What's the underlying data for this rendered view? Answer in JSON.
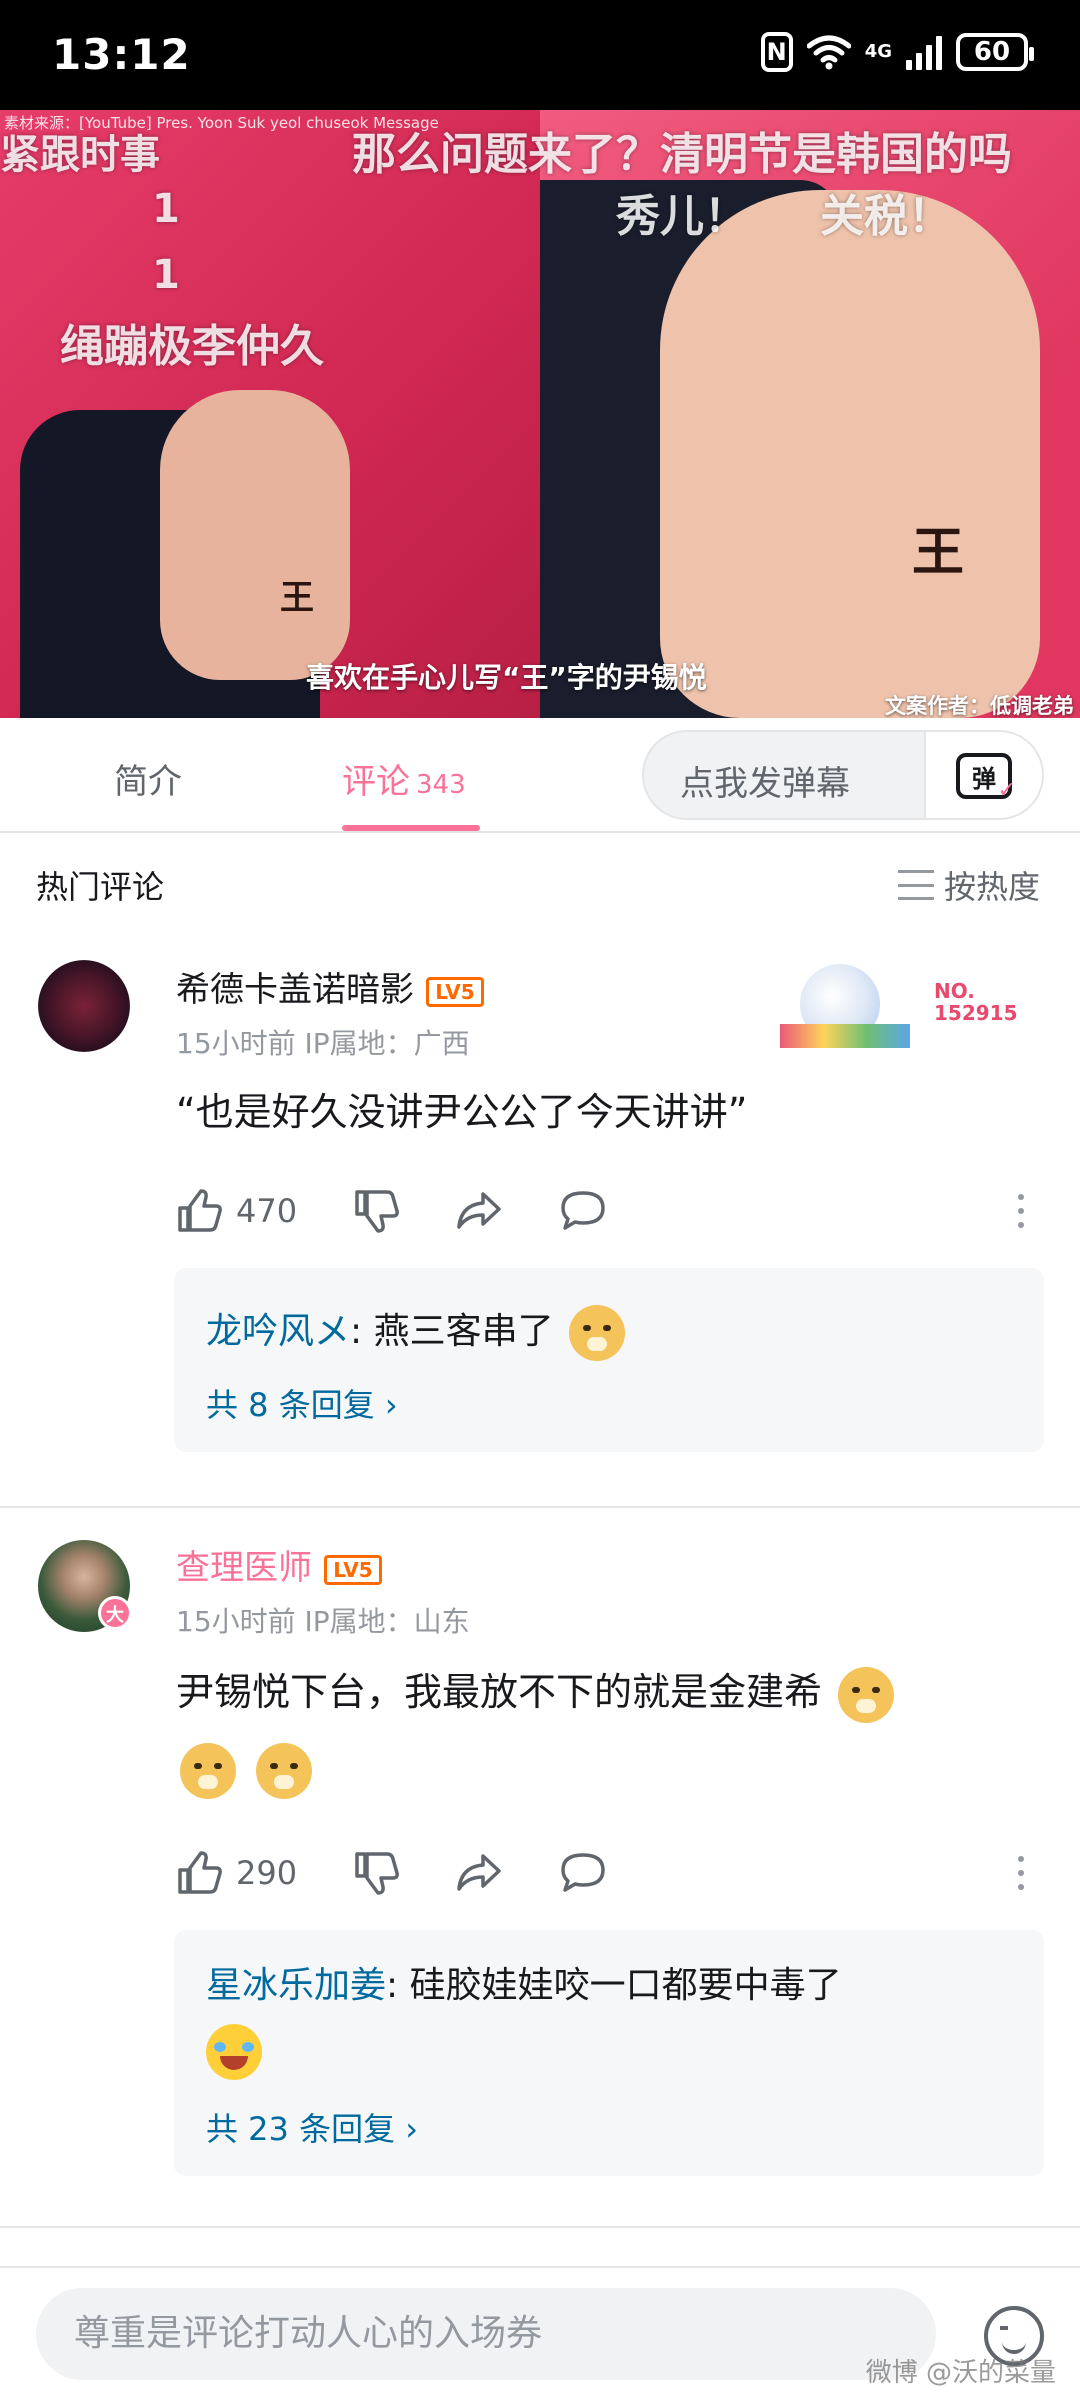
{
  "status_bar": {
    "time": "13:12",
    "network": "4G",
    "battery": "60"
  },
  "video": {
    "source_text": "素材来源：[YouTube] Pres. Yoon Suk yeol chuseok Message",
    "danmaku": [
      "紧跟时事",
      "1",
      "1",
      "绳蹦极李仲久",
      "那么问题来了？清明节是韩国的吗",
      "秀儿！",
      "关税！"
    ],
    "palm_mark": "王",
    "caption": "喜欢在手心儿写“王”字的尹锡悦",
    "author": "文案作者：低调老弟"
  },
  "tabs": {
    "intro": "简介",
    "comments": "评论",
    "comment_count": "343",
    "danmu_placeholder": "点我发弹幕",
    "danmu_button": "弹"
  },
  "section": {
    "title": "热门评论",
    "sort": "按热度"
  },
  "comments": [
    {
      "username": "希德卡盖诺暗影",
      "level": "LV5",
      "meta": "15小时前 IP属地：广西",
      "badge_no": "NO.",
      "badge_num": "152915",
      "text": "“也是好久没讲尹公公了今天讲讲”",
      "likes": "470",
      "reply_user": "龙吟风メ",
      "reply_text": ": 燕三客串了",
      "reply_more": "共 8 条回复 ›"
    },
    {
      "username": "查理医师",
      "level": "LV5",
      "meta": "15小时前 IP属地：山东",
      "avatar_badge": "大",
      "text": "尹锡悦下台，我最放不下的就是金建希",
      "likes": "290",
      "reply_user": "星冰乐加姜",
      "reply_text": ": 硅胶娃娃咬一口都要中毒了",
      "reply_more": "共 23 条回复 ›"
    }
  ],
  "input": {
    "placeholder": "尊重是评论打动人心的入场券"
  },
  "watermark": "微博 @沃的菜量",
  "colors": {
    "accent": "#fb7299",
    "reply_link": "#00699d",
    "level": "#ff6a00",
    "uname_vip": "#fb7299"
  }
}
